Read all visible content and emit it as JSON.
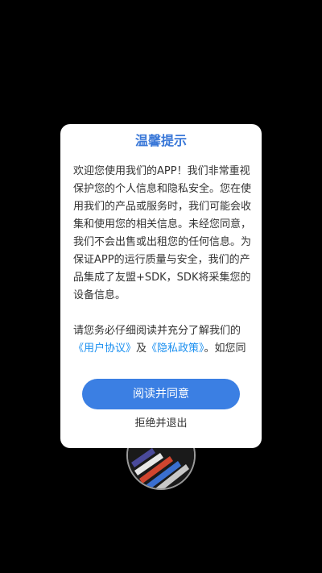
{
  "dialog": {
    "title": "温馨提示",
    "paragraph1": "欢迎您使用我们的APP！我们非常重视保护您的个人信息和隐私安全。您在使用我们的产品或服务时，我们可能会收集和使用您的相关信息。未经您同意，我们不会出售或出租您的任何信息。为保证APP的运行质量与安全，我们的产品集成了友盟+SDK，SDK将采集您的设备信息。",
    "paragraph2_prefix": "请您务必仔细阅读并充分了解我们的",
    "user_agreement_link": "《用户协议》",
    "and_text": "及",
    "privacy_policy_link": "《隐私政策》",
    "paragraph2_suffix": "。如您同意请点击“同意”开始接受我们的服",
    "agree_button": "阅读并同意",
    "exit_button": "拒绝并退出"
  },
  "colors": {
    "background": "#000000",
    "dialog": "#ffffff",
    "title": "#3a78d8",
    "link": "#1a8ff0",
    "primary_button": "#3b7fe3"
  },
  "icons": {
    "background_logo": "app-logo-icon"
  }
}
